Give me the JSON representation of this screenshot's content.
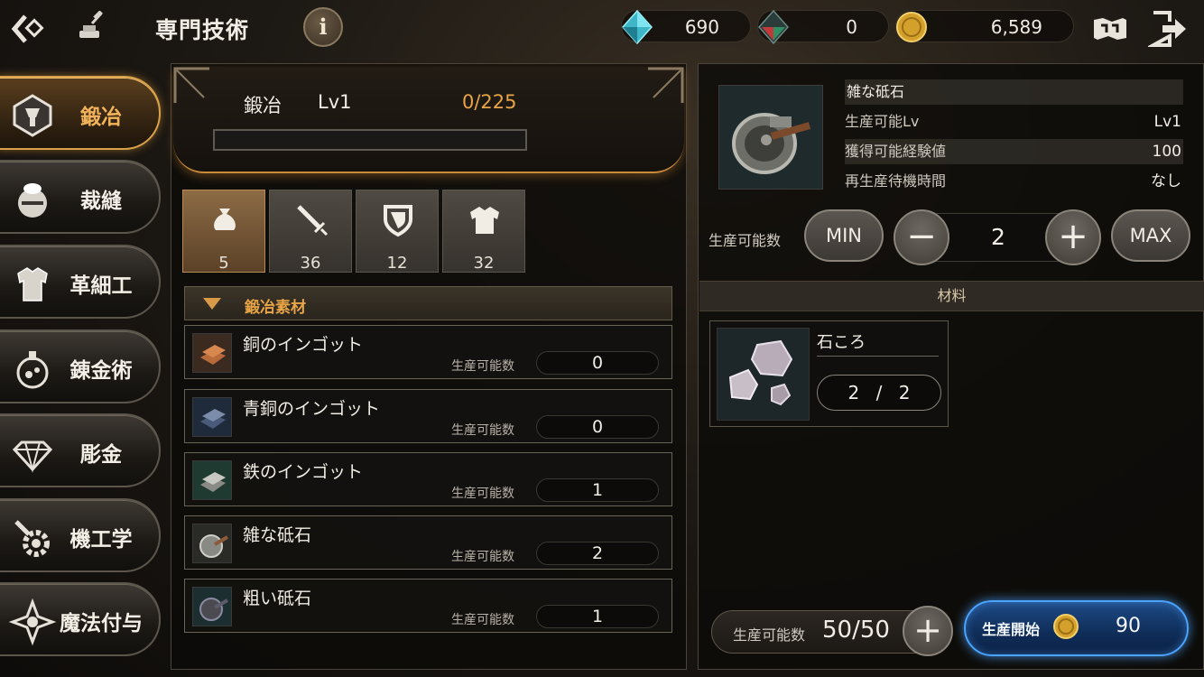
{
  "header": {
    "title": "専門技術",
    "info_label": "i"
  },
  "currencies": [
    {
      "name": "blue-crystal",
      "value": "690",
      "color": "#5ed4e6"
    },
    {
      "name": "red-crystal",
      "value": "0",
      "color": "#c0393b"
    },
    {
      "name": "gold-coin",
      "value": "6,589",
      "color": "#d4a02c"
    }
  ],
  "categories": [
    {
      "label": "鍛冶",
      "active": true
    },
    {
      "label": "裁縫",
      "active": false
    },
    {
      "label": "革細工",
      "active": false
    },
    {
      "label": "錬金術",
      "active": false
    },
    {
      "label": "彫金",
      "active": false
    },
    {
      "label": "機工学",
      "active": false
    },
    {
      "label": "魔法付与",
      "active": false
    }
  ],
  "level": {
    "name": "鍛冶",
    "lv": "Lv1",
    "exp": "0/225",
    "progress": 0
  },
  "filters": [
    {
      "icon": "bag-icon",
      "count": "5",
      "active": true
    },
    {
      "icon": "sword-icon",
      "count": "36",
      "active": false
    },
    {
      "icon": "shield-icon",
      "count": "12",
      "active": false
    },
    {
      "icon": "armor-icon",
      "count": "32",
      "active": false
    }
  ],
  "section": {
    "label": "鍛冶素材"
  },
  "items": [
    {
      "name": "銅のインゴット",
      "prod_label": "生産可能数",
      "prod_value": "0"
    },
    {
      "name": "青銅のインゴット",
      "prod_label": "生産可能数",
      "prod_value": "0"
    },
    {
      "name": "鉄のインゴット",
      "prod_label": "生産可能数",
      "prod_value": "1"
    },
    {
      "name": "雑な砥石",
      "prod_label": "生産可能数",
      "prod_value": "2"
    },
    {
      "name": "粗い砥石",
      "prod_label": "生産可能数",
      "prod_value": "1"
    }
  ],
  "detail": {
    "name": "雑な砥石",
    "stats": [
      {
        "label": "生産可能Lv",
        "value": "Lv1"
      },
      {
        "label": "獲得可能経験値",
        "value": "100"
      },
      {
        "label": "再生産待機時間",
        "value": "なし"
      }
    ]
  },
  "quantity": {
    "label": "生産可能数",
    "min_label": "MIN",
    "max_label": "MAX",
    "minus_label": "−",
    "plus_label": "+",
    "value": "2"
  },
  "materials": {
    "header": "材料",
    "items": [
      {
        "name": "石ころ",
        "count": "2 / 2"
      }
    ]
  },
  "capacity": {
    "label": "生産可能数",
    "value": "50/50",
    "plus_label": "+"
  },
  "start": {
    "label": "生産開始",
    "cost": "90"
  }
}
